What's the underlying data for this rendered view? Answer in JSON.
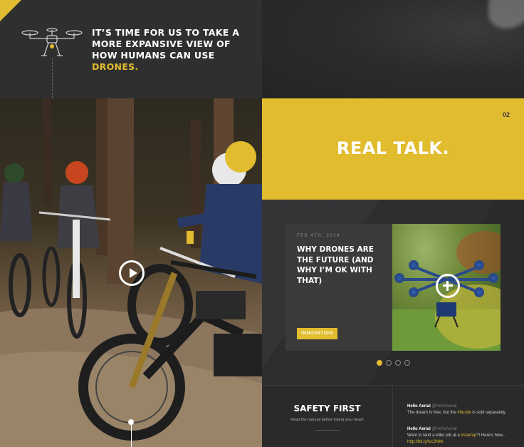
{
  "hero": {
    "headline_main": "IT’S TIME FOR US TO TAKE A MORE EXPANSIVE VIEW OF HOW HUMANS CAN USE",
    "headline_highlight": "DRONES."
  },
  "video": {
    "play_icon": "play-icon"
  },
  "realtalk": {
    "title": "REAL TALK.",
    "page_num": "02"
  },
  "post": {
    "date": "FEB 4TH, 2014",
    "title": "WHY DRONES ARE THE FUTURE (AND WHY I’M OK WITH THAT)",
    "tag": "INNOVATION",
    "plus_icon": "plus-icon"
  },
  "carousel": {
    "count": 4,
    "active": 0
  },
  "safety": {
    "title": "SAFETY FIRST",
    "subtitle": "Read the manual before losing your head!"
  },
  "tweets": [
    {
      "name": "Hello Aerial",
      "handle": "@HelloAerial",
      "before": "The dream is free, but the ",
      "tag": "#hustle",
      "after": " is sold separately.",
      "link": ""
    },
    {
      "name": "Hello Aerial",
      "handle": "@HelloAerial",
      "before": "Want to land a killer job at a ",
      "tag": "#startup",
      "after": "?! Here's how...",
      "link": "http://bit.ly/Icc3Nhk"
    }
  ],
  "colors": {
    "accent": "#e2bc2f",
    "dark": "#2a2a2b",
    "card": "#3a3a3b"
  }
}
